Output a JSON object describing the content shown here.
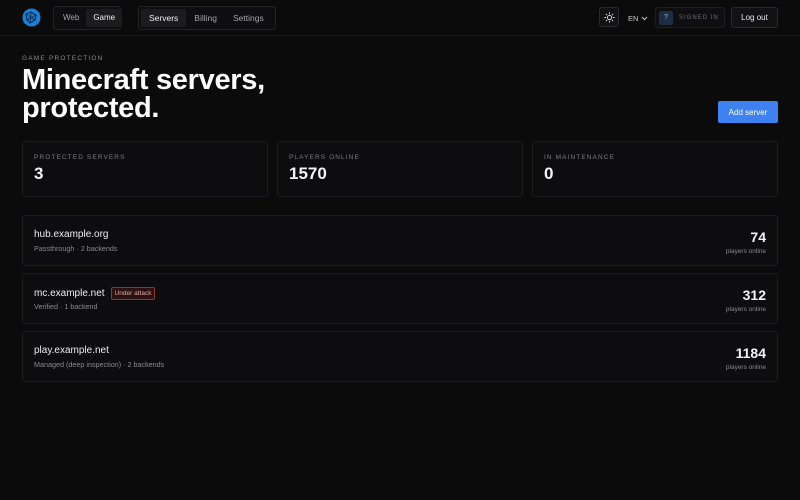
{
  "nav": {
    "mode_tabs": [
      {
        "label": "Web",
        "active": false
      },
      {
        "label": "Game",
        "active": true
      }
    ],
    "main_tabs": [
      {
        "label": "Servers",
        "active": true
      },
      {
        "label": "Billing",
        "active": false
      },
      {
        "label": "Settings",
        "active": false
      }
    ],
    "theme_icon": "sun-icon",
    "language": "EN",
    "user_avatar": "?",
    "signed_in_label": "SIGNED IN",
    "logout_label": "Log out"
  },
  "header": {
    "eyebrow": "GAME PROTECTION",
    "title": "Minecraft servers, protected.",
    "add_button_label": "Add server"
  },
  "stats": [
    {
      "label": "PROTECTED SERVERS",
      "value": "3"
    },
    {
      "label": "PLAYERS ONLINE",
      "value": "1570"
    },
    {
      "label": "IN MAINTENANCE",
      "value": "0"
    }
  ],
  "servers": [
    {
      "host": "hub.example.org",
      "meta": "Passthrough · 2 backends",
      "badge": "",
      "players": "74",
      "players_label": "players online"
    },
    {
      "host": "mc.example.net",
      "meta": "Verified · 1 backend",
      "badge": "Under attack",
      "players": "312",
      "players_label": "players online"
    },
    {
      "host": "play.example.net",
      "meta": "Managed (deep inspection) · 2 backends",
      "badge": "",
      "players": "1184",
      "players_label": "players online"
    }
  ],
  "colors": {
    "accent": "#3d82f0",
    "background": "#0b0b0c",
    "danger": "#8e3535"
  }
}
